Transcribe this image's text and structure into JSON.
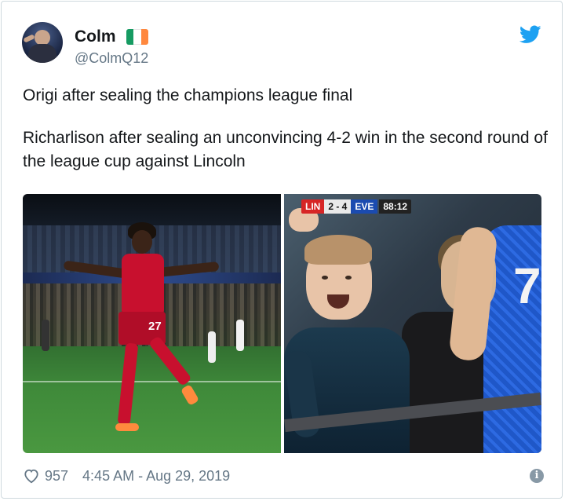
{
  "tweet": {
    "author_name": "Colm",
    "handle": "@ColmQ12",
    "flag_colors": [
      "#169b62",
      "#ffffff",
      "#ff883e"
    ],
    "paragraphs": [
      "Origi after sealing the champions league final",
      "Richarlison after sealing an unconvincing 4-2 win in the second round of the league cup against Lincoln"
    ],
    "likes": "957",
    "timestamp": "4:45 AM - Aug 29, 2019"
  },
  "media": {
    "left_photo": {
      "jersey_number": "27"
    },
    "right_photo": {
      "scoreboard": {
        "team_a": "LIN",
        "score": "2 - 4",
        "team_b": "EVE",
        "time": "88:12"
      },
      "shirt_number": "7"
    }
  },
  "icons": {
    "brand": "twitter-bird-icon",
    "like": "heart-icon",
    "info": "info-icon"
  },
  "colors": {
    "twitter_blue": "#1da1f2",
    "secondary_text": "#657786",
    "border": "#cfd9de"
  }
}
